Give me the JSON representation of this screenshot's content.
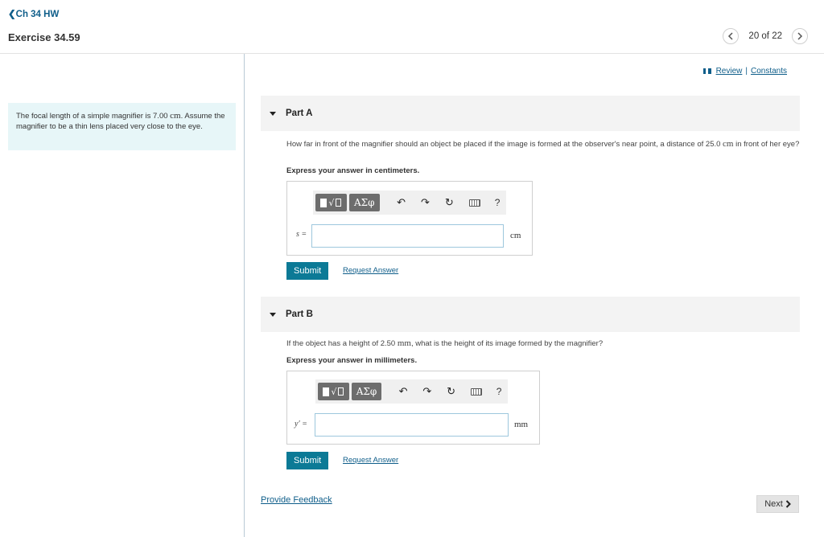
{
  "header": {
    "back_label": "Ch 34 HW",
    "exercise_title": "Exercise 34.59",
    "pager": "20 of 22"
  },
  "problem": {
    "text_before": "The focal length of a simple magnifier is 7.00 ",
    "unit": "cm",
    "text_after": ". Assume the magnifier to be a thin lens placed very close to the eye."
  },
  "links": {
    "review": "Review",
    "separator": "|",
    "constants": "Constants"
  },
  "toolbar": {
    "greek": "ΑΣφ",
    "radical": "√",
    "help": "?"
  },
  "part_a": {
    "title": "Part A",
    "question_before": "How far in front of the magnifier should an object be placed if the image is formed at the observer's near point, a distance of 25.0 ",
    "question_unit": "cm",
    "question_after": " in front of her eye?",
    "express": "Express your answer in centimeters.",
    "variable": "s =",
    "value": "",
    "unit": "cm",
    "submit": "Submit",
    "request": "Request Answer"
  },
  "part_b": {
    "title": "Part B",
    "question_before": "If the object has a height of 2.50 ",
    "question_unit": "mm",
    "question_after": ", what is the height of its image formed by the magnifier?",
    "express": "Express your answer in millimeters.",
    "variable": "y′ =",
    "value": "",
    "unit": "mm",
    "submit": "Submit",
    "request": "Request Answer"
  },
  "footer": {
    "feedback": "Provide Feedback",
    "next": "Next"
  },
  "icons": {
    "undo": "undo-icon",
    "redo": "redo-icon",
    "reset": "reset-icon",
    "keyboard": "keyboard-icon",
    "prev": "chevron-left-icon",
    "next": "chevron-right-icon"
  },
  "colors": {
    "accent": "#0c7a96",
    "link": "#0f5e8a",
    "problem_bg": "#e7f6f8"
  }
}
